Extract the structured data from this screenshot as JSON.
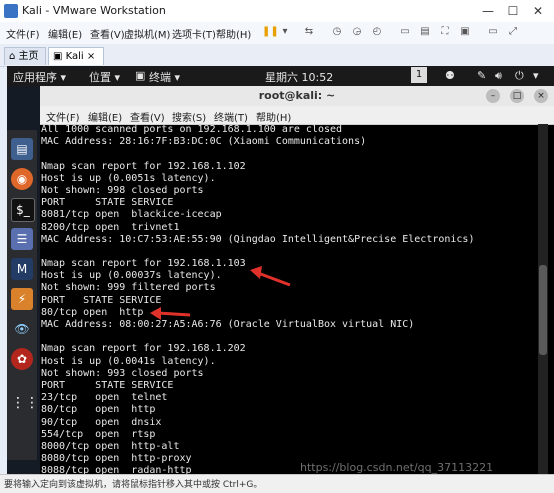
{
  "vm": {
    "title": "Kali - VMware Workstation",
    "menu": [
      "文件(F)",
      "编辑(E)",
      "查看(V)",
      "虚拟机(M)",
      "选项卡(T)",
      "帮助(H)"
    ],
    "tabs": [
      {
        "label": "主页",
        "active": false
      },
      {
        "label": "Kali",
        "active": true
      }
    ]
  },
  "kali_panel": {
    "applications": "应用程序 ▾",
    "places": "位置 ▾",
    "terminal": "终端 ▾",
    "clock": "星期六 10:52",
    "workspace": "1"
  },
  "terminal": {
    "title": "root@kali: ~",
    "menu": [
      "文件(F)",
      "编辑(E)",
      "查看(V)",
      "搜索(S)",
      "终端(T)",
      "帮助(H)"
    ],
    "lines": [
      "All 1000 scanned ports on 192.168.1.100 are closed",
      "MAC Address: 28:16:7F:B3:DC:0C (Xiaomi Communications)",
      "",
      "Nmap scan report for 192.168.1.102",
      "Host is up (0.0051s latency).",
      "Not shown: 998 closed ports",
      "PORT     STATE SERVICE",
      "8081/tcp open  blackice-icecap",
      "8200/tcp open  trivnet1",
      "MAC Address: 10:C7:53:AE:55:90 (Qingdao Intelligent&Precise Electronics)",
      "",
      "Nmap scan report for 192.168.1.103",
      "Host is up (0.00037s latency).",
      "Not shown: 999 filtered ports",
      "PORT   STATE SERVICE",
      "80/tcp open  http",
      "MAC Address: 08:00:27:A5:A6:76 (Oracle VirtualBox virtual NIC)",
      "",
      "Nmap scan report for 192.168.1.202",
      "Host is up (0.0041s latency).",
      "Not shown: 993 closed ports",
      "PORT     STATE SERVICE",
      "23/tcp   open  telnet",
      "80/tcp   open  http",
      "90/tcp   open  dnsix",
      "554/tcp  open  rtsp",
      "8000/tcp open  http-alt",
      "8080/tcp open  http-proxy",
      "8088/tcp open  radan-http"
    ]
  },
  "status_bar": "要将输入定向到该虚拟机，请将鼠标指针移入其中或按 Ctrl+G。",
  "watermark": "https://blog.csdn.net/qq_37113221",
  "colors": {
    "annotation_arrow": "#e0322a",
    "terminal_bg": "#000000",
    "panel_bg": "#1a1a1a"
  }
}
